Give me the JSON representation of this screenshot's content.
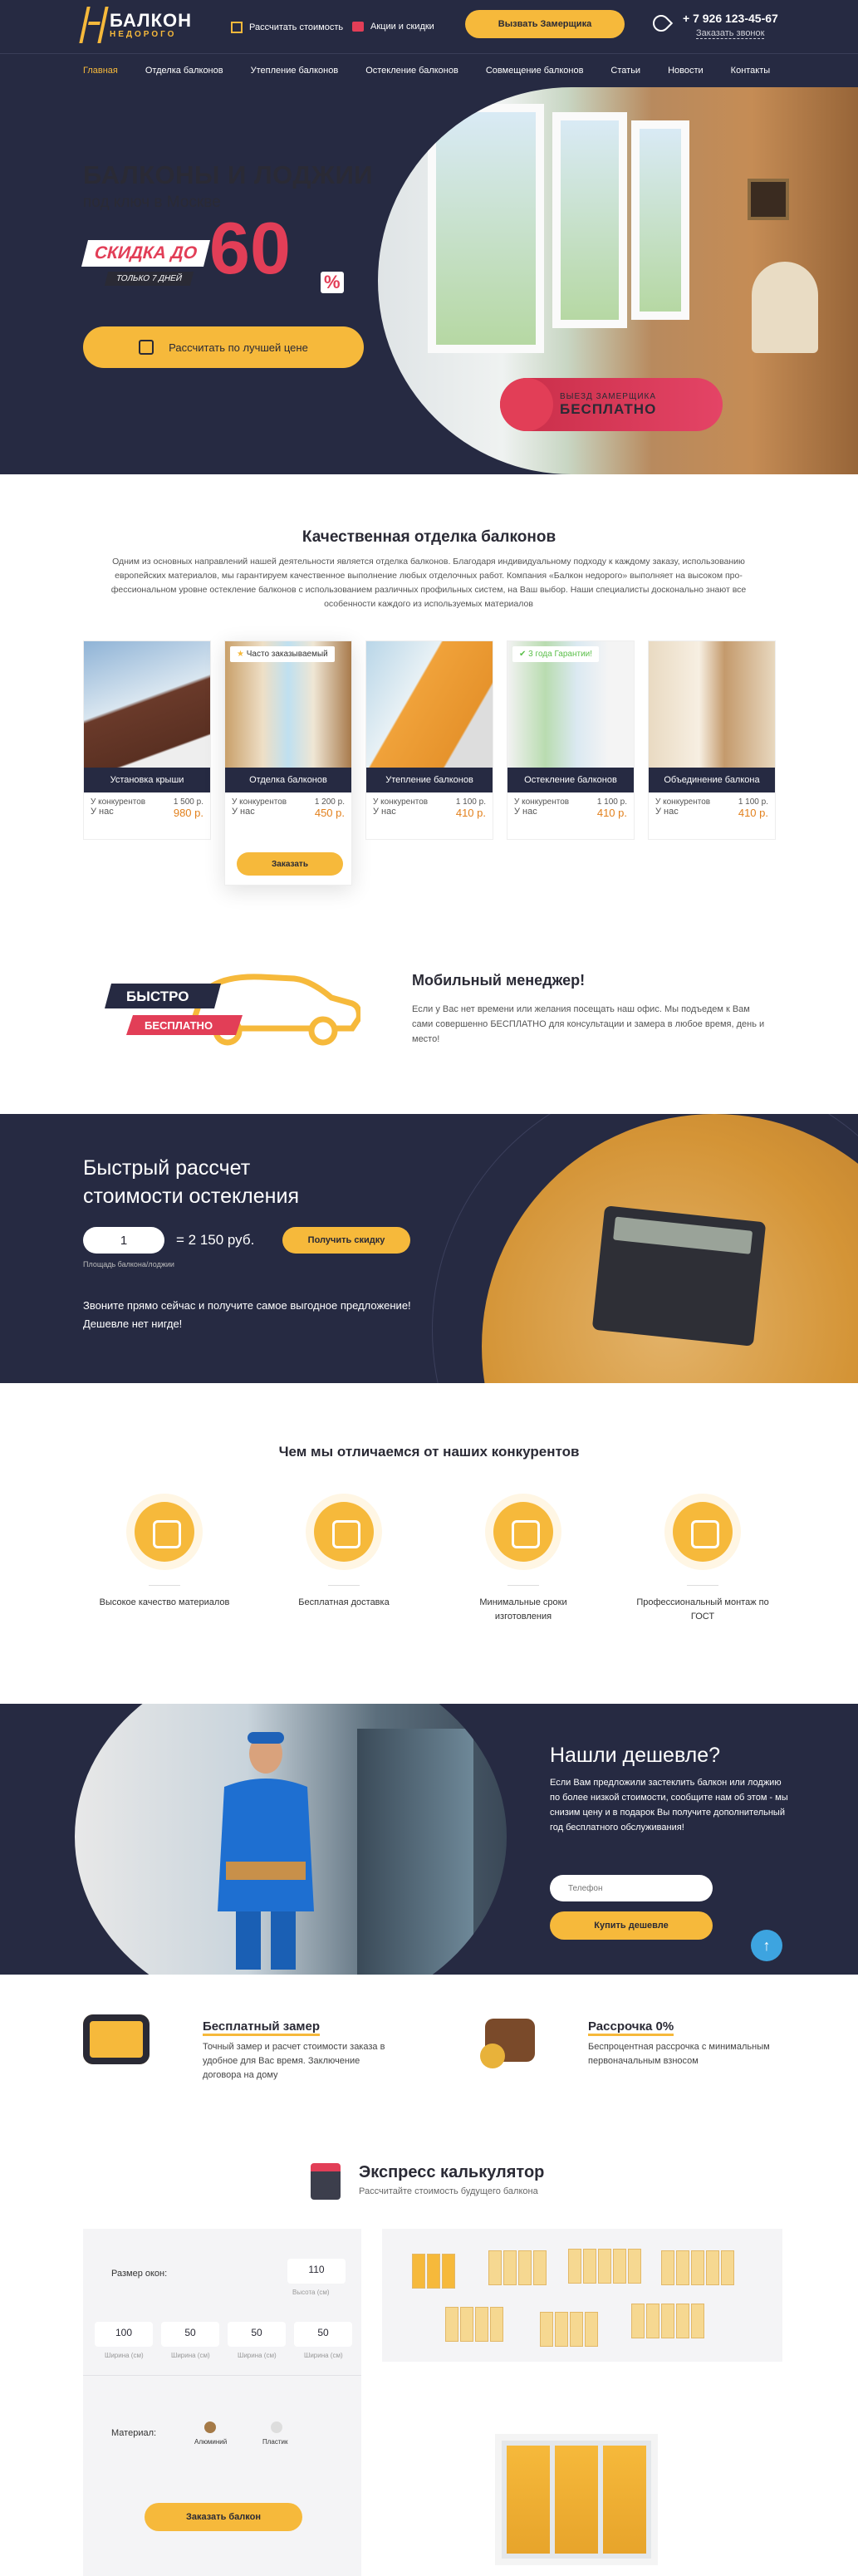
{
  "header": {
    "logo_title": "БАЛКОН",
    "logo_sub": "НЕДОРОГО",
    "link_calc": "Рассчитать стоимость",
    "link_promo": "Акции и скидки",
    "btn_zamer": "Вызвать Замерщика",
    "phone": "+ 7 926 123-45-67",
    "callback": "Заказать звонок"
  },
  "nav": [
    "Главная",
    "Отделка балконов",
    "Утепление балконов",
    "Остекление балконов",
    "Совмещение балконов",
    "Статьи",
    "Новости",
    "Контакты"
  ],
  "hero": {
    "title": "БАЛКОНЫ И ЛОДЖИИ",
    "subtitle": "под ключ в Москве",
    "sale": "СКИДКА ДО",
    "sale_days": "ТОЛЬКО 7 ДНЕЙ",
    "sale_value": "60",
    "sale_pct": "%",
    "btn": "Рассчитать по лучшей цене",
    "badge_1": "ВЫЕЗД ЗАМЕРЩИКА",
    "badge_2": "БЕСПЛАТНО"
  },
  "quality": {
    "title": "Качественная отделка балконов",
    "text": "Одним из основных направлений нашей деятельности является отделка балконов. Благодаря индивидуальному подходу к каждому заказу, использованию европейских материалов, мы гарантируем качественное выполнение любых отделочных работ. Компания «Балкон недорого» выполняет на высоком про- фессиональном уровне остекление балконов с использованием различных профильных систем, на Ваш выбор. Наши специалисты досконально знают все особенности каждого из используемых материалов",
    "cards": [
      {
        "title": "Установка крыши",
        "comp_label": "У конкурентов",
        "comp": "1 500 р.",
        "our_label": "У нас",
        "our": "980 р."
      },
      {
        "title": "Отделка балконов",
        "comp_label": "У конкурентов",
        "comp": "1 200 р.",
        "our_label": "У нас",
        "our": "450 р.",
        "tag": "Часто заказываемый"
      },
      {
        "title": "Утепление балконов",
        "comp_label": "У конкурентов",
        "comp": "1 100 р.",
        "our_label": "У нас",
        "our": "410 р."
      },
      {
        "title": "Остекление балконов",
        "comp_label": "У конкурентов",
        "comp": "1 100 р.",
        "our_label": "У нас",
        "our": "410 р.",
        "tag": "3 года Гарантии!"
      },
      {
        "title": "Объединение балкона",
        "comp_label": "У конкурентов",
        "comp": "1 100 р.",
        "our_label": "У нас",
        "our": "410 р."
      }
    ],
    "btn_order": "Заказать"
  },
  "mobile": {
    "car_1": "БЫСТРО",
    "car_2": "БЕСПЛАТНО",
    "title": "Мобильный менеджер!",
    "text": "Если у Вас нет времени или желания посещать наш офис. Мы подъедем к Вам сами совершенно БЕСПЛАТНО для консультации и замера в любое время, день и место!"
  },
  "calc": {
    "title_1": "Быстрый рассчет",
    "title_2": "стоимости остекления",
    "value": "1",
    "result": "=  2 150 руб.",
    "btn": "Получить скидку",
    "label": "Площадь балкона/лоджии",
    "note": "Звоните прямо сейчас и получите самое выгодное предложение! Дешевле нет нигде!"
  },
  "differ": {
    "title": "Чем мы отличаемся от наших конкурентов",
    "items": [
      "Высокое качество материалов",
      "Бесплатная доставка",
      "Минимальные сроки изготовления",
      "Профессиональный монтаж по ГОСТ"
    ]
  },
  "cheaper": {
    "title": "Нашли дешевле?",
    "text": "Если Вам предложили застеклить балкон или лоджию по более низкой стоимости, сообщите нам об этом - мы снизим цену и в подарок Вы получите дополнительный год бесплатного обслуживания!",
    "placeholder": "Телефон",
    "btn": "Купить дешевле"
  },
  "extras": {
    "e1_title": "Бесплатный замер",
    "e1_text": "Точный замер и расчет стоимости заказа в удобное для Вас время. Заключение договора на дому",
    "e2_title": "Рассрочка 0%",
    "e2_text": "Беспроцентная рассрочка с минимальным первоначальным взносом"
  },
  "express": {
    "title": "Экспресс калькулятор",
    "subtitle": "Рассчитайте стоимость будущего балкона",
    "size_label": "Размер окон:",
    "height": "110",
    "height_label": "Высота (см)",
    "widths": [
      "100",
      "50",
      "50",
      "50"
    ],
    "width_label": "Ширина (см)",
    "material_label": "Материал:",
    "materials": [
      "Алюминий",
      "Пластик"
    ],
    "btn": "Заказать балкон"
  }
}
